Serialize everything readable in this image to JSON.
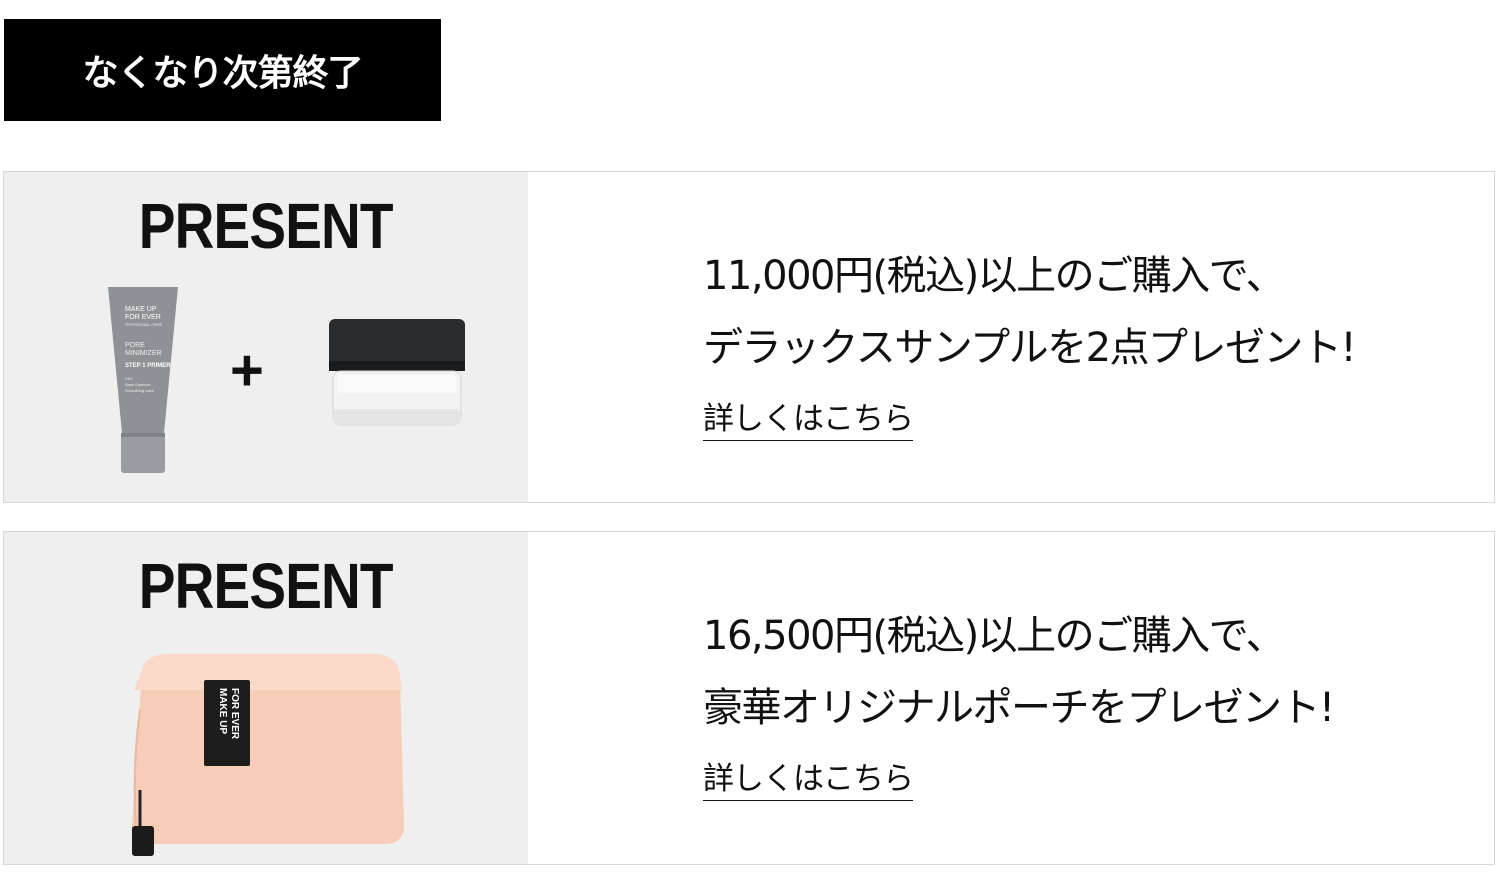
{
  "banner": {
    "label": "なくなり次第終了"
  },
  "promotions": [
    {
      "heading": "PRESENT",
      "line1": "11,000円(税込)以上のご購入で、",
      "line2": "デラックスサンプルを2点プレゼント!",
      "link_label": "詳しくはこちら",
      "product": {
        "tube_text": [
          "MAKE UP",
          "FOR EVER",
          "PROFESSIONAL • PARIS",
          "PORE",
          "MINIMIZER",
          "STEP 1 PRIMER",
          "24H",
          "Base Essence",
          "Smoothing base"
        ],
        "plus": "+"
      }
    },
    {
      "heading": "PRESENT",
      "line1": "16,500円(税込)以上のご購入で、",
      "line2": "豪華オリジナルポーチをプレゼント!",
      "link_label": "詳しくはこちら",
      "product": {
        "tag_text": [
          "MAKE UP",
          "FOR EVER"
        ]
      }
    }
  ],
  "colors": {
    "banner_bg": "#000000",
    "image_bg": "#efefef",
    "pouch": "#f8cdb8",
    "tube": "#8e9196"
  }
}
